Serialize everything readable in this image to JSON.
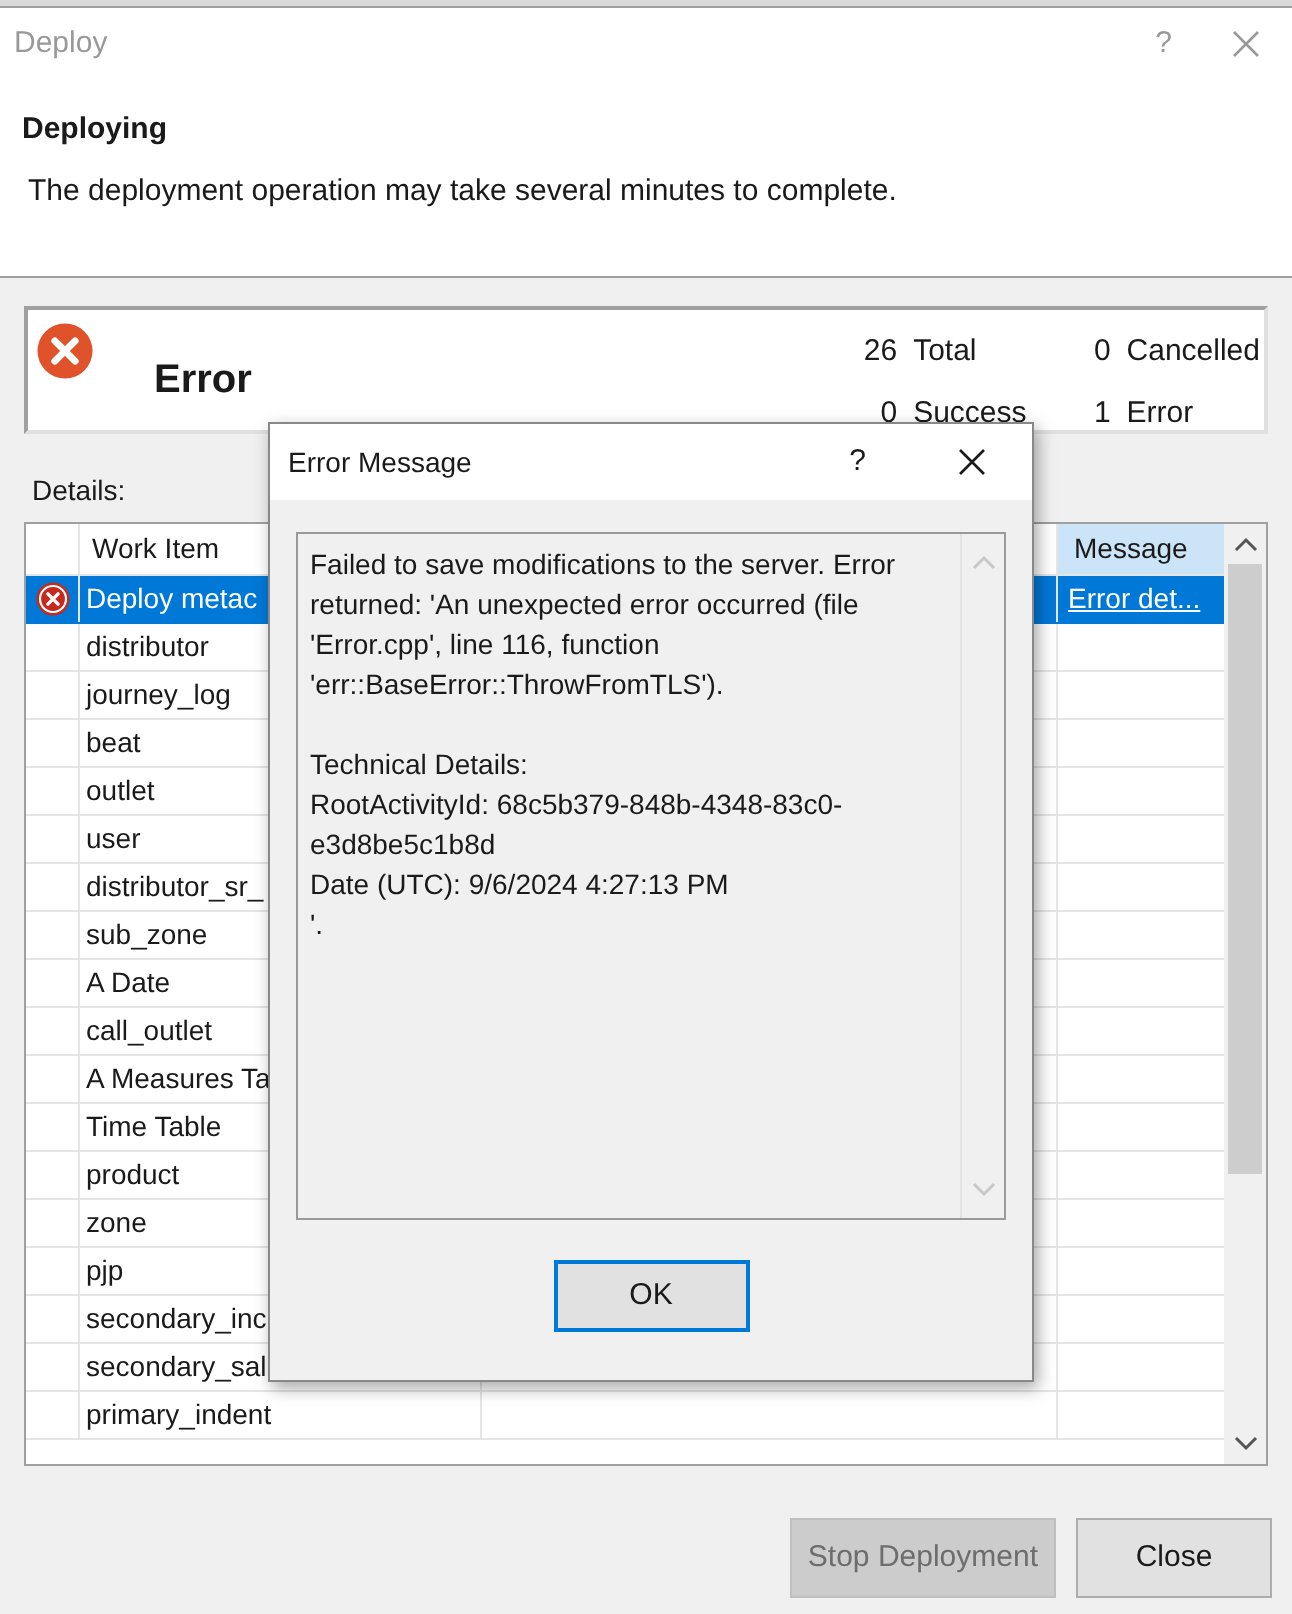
{
  "window": {
    "title": "Deploy",
    "help": "?"
  },
  "header": {
    "title": "Deploying",
    "description": "The deployment operation may take several minutes to complete."
  },
  "summary": {
    "status": "Error",
    "stats": [
      {
        "value": "26",
        "label": "Total"
      },
      {
        "value": "0",
        "label": "Cancelled"
      },
      {
        "value": "0",
        "label": "Success"
      },
      {
        "value": "1",
        "label": "Error"
      }
    ]
  },
  "details_label": "Details:",
  "table": {
    "columns": [
      "Work Item",
      "Message"
    ],
    "rows": [
      {
        "work_item": "Deploy metac",
        "error": true,
        "selected": true,
        "message": "Error det..."
      },
      {
        "work_item": "distributor",
        "error": false,
        "selected": false
      },
      {
        "work_item": "journey_log",
        "error": false,
        "selected": false
      },
      {
        "work_item": "beat",
        "error": false,
        "selected": false
      },
      {
        "work_item": "outlet",
        "error": false,
        "selected": false
      },
      {
        "work_item": "user",
        "error": false,
        "selected": false
      },
      {
        "work_item": "distributor_sr_",
        "error": false,
        "selected": false
      },
      {
        "work_item": "sub_zone",
        "error": false,
        "selected": false
      },
      {
        "work_item": "A Date",
        "error": false,
        "selected": false
      },
      {
        "work_item": "call_outlet",
        "error": false,
        "selected": false
      },
      {
        "work_item": "A Measures Ta",
        "error": false,
        "selected": false
      },
      {
        "work_item": "Time Table",
        "error": false,
        "selected": false
      },
      {
        "work_item": "product",
        "error": false,
        "selected": false
      },
      {
        "work_item": "zone",
        "error": false,
        "selected": false
      },
      {
        "work_item": "pjp",
        "error": false,
        "selected": false
      },
      {
        "work_item": "secondary_inc",
        "error": false,
        "selected": false
      },
      {
        "work_item": "secondary_sal",
        "error": false,
        "selected": false
      },
      {
        "work_item": "primary_indent",
        "error": false,
        "selected": false
      }
    ]
  },
  "buttons": [
    {
      "label": "Stop Deployment",
      "disabled": true
    },
    {
      "label": "Close",
      "disabled": false
    }
  ],
  "dialog": {
    "title": "Error Message",
    "help": "?",
    "message_paragraphs": [
      [
        "Failed to save modifications to the server. Error returned: 'An unexpected error occurred (file 'Error.cpp', line 116, function 'err::BaseError::ThrowFromTLS')."
      ],
      [
        "Technical Details:",
        "RootActivityId: 68c5b379-848b-4348-83c0-e3d8be5c1b8d",
        "Date (UTC): 9/6/2024 4:27:13 PM",
        "'."
      ]
    ],
    "ok": "OK"
  }
}
